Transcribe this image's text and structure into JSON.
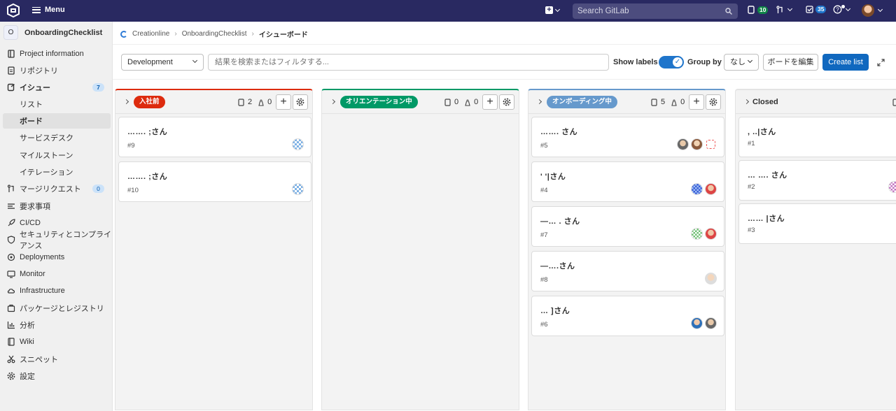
{
  "topbar": {
    "menu_label": "Menu",
    "search_placeholder": "Search GitLab",
    "issues_count": "10",
    "todo_count": "35"
  },
  "sidebar": {
    "project_avatar": "O",
    "project_name": "OnboardingChecklist",
    "items": [
      {
        "label": "Project information",
        "icon": "info-icon"
      },
      {
        "label": "リポジトリ",
        "icon": "doc-icon"
      },
      {
        "label": "イシュー",
        "icon": "issues-icon",
        "badge": "7"
      },
      {
        "label": "リスト"
      },
      {
        "label": "ボード"
      },
      {
        "label": "サービスデスク"
      },
      {
        "label": "マイルストーン"
      },
      {
        "label": "イテレーション"
      },
      {
        "label": "マージリクエスト",
        "icon": "merge-request-icon",
        "badge": "0"
      },
      {
        "label": "要求事項",
        "icon": "requirements-icon"
      },
      {
        "label": "CI/CD",
        "icon": "rocket-icon"
      },
      {
        "label": "セキュリティとコンプライアンス",
        "icon": "shield-icon"
      },
      {
        "label": "Deployments",
        "icon": "deployments-icon"
      },
      {
        "label": "Monitor",
        "icon": "monitor-icon"
      },
      {
        "label": "Infrastructure",
        "icon": "cloud-icon"
      },
      {
        "label": "パッケージとレジストリ",
        "icon": "package-icon"
      },
      {
        "label": "分析",
        "icon": "chart-icon"
      },
      {
        "label": "Wiki",
        "icon": "book-icon"
      },
      {
        "label": "スニペット",
        "icon": "scissors-icon"
      },
      {
        "label": "設定",
        "icon": "gear-icon"
      }
    ]
  },
  "breadcrumb": {
    "group": "Creationline",
    "project": "OnboardingChecklist",
    "current": "イシューボード"
  },
  "filters": {
    "board_select": "Development",
    "search_placeholder": "結果を検索またはフィルタする...",
    "show_labels": "Show labels",
    "group_by": "Group by",
    "group_by_value": "なし",
    "edit_board": "ボードを編集",
    "create_list": "Create list"
  },
  "lists": [
    {
      "label": "入社前",
      "color": "#dd2b0e",
      "issues": "2",
      "weight": "0",
      "cards": [
        {
          "title": "……. ;さん",
          "number": "#9"
        },
        {
          "title": "……. ;さん",
          "number": "#10"
        }
      ]
    },
    {
      "label": "オリエンテーション中",
      "color": "#009966",
      "issues": "0",
      "weight": "0",
      "cards": []
    },
    {
      "label": "オンボーディング中",
      "color": "#6699cc",
      "issues": "5",
      "weight": "0",
      "cards": [
        {
          "title": "……. さん",
          "number": "#5"
        },
        {
          "title": "' '|さん",
          "number": "#4"
        },
        {
          "title": "—… . さん",
          "number": "#7"
        },
        {
          "title": "—….さん",
          "number": "#8"
        },
        {
          "title": "… ]さん",
          "number": "#6"
        }
      ]
    },
    {
      "label": "Closed",
      "cards": [
        {
          "title": ", ..|さん",
          "number": "#1"
        },
        {
          "title": "… …. さん",
          "number": "#2"
        },
        {
          "title": "…… |さん",
          "number": "#3"
        }
      ]
    }
  ]
}
